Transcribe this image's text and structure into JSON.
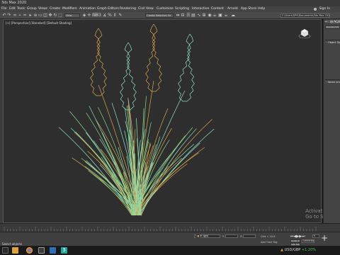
{
  "app": {
    "title": "3ds Max 2020"
  },
  "menus": [
    "File",
    "Edit",
    "Tools",
    "Group",
    "Views",
    "Create",
    "Modifiers",
    "Animation",
    "Graph Editors",
    "Rendering",
    "Civil View",
    "Customize",
    "Scripting",
    "Interactive",
    "Content",
    "Arnold",
    "App Store",
    "Help"
  ],
  "account": {
    "sign_in": "Sign In"
  },
  "toolbar": {
    "view_dd": "View",
    "selection_set_dd": "Create Selection Se",
    "workspace_path": "C:\\Users\\SPV\\Documents\\3ds Max 2020"
  },
  "viewport": {
    "label": "[+] [Perspective] [Standard] [Default Shading]",
    "watermark_line1": "Activate",
    "watermark_line2": "Go to Se"
  },
  "command_panel": {
    "tab_icons": [
      "+",
      "▭",
      "◍",
      "◔",
      "▤",
      "⚙"
    ],
    "category_dd": "Standard Primitives",
    "section_object_type": "Object Type",
    "section_name_color": "Name and Color"
  },
  "status": {
    "selected": "None Selected",
    "coords": {
      "x_label": "X:",
      "y_label": "Y:",
      "z_label": "Z:"
    },
    "grid": "Grid = 10.0",
    "add_time_tag": "Add Time Tag",
    "auto_key": "Auto Key",
    "set_key": "Set Key",
    "selected_dd": "Selected",
    "frame": "0",
    "message": "Select objects"
  },
  "taskbar": {
    "ticker_symbol": "USD/GBP",
    "ticker_change": "+1.20%",
    "icons": [
      "search",
      "file-explorer",
      "chrome",
      "media",
      "photos",
      "3ds-max"
    ]
  },
  "colors": {
    "grass_yellow": "#d8a84a",
    "grass_teal": "#8fe0c4",
    "grass_green": "#8ed88a",
    "ticker_green": "#4ec94e"
  }
}
